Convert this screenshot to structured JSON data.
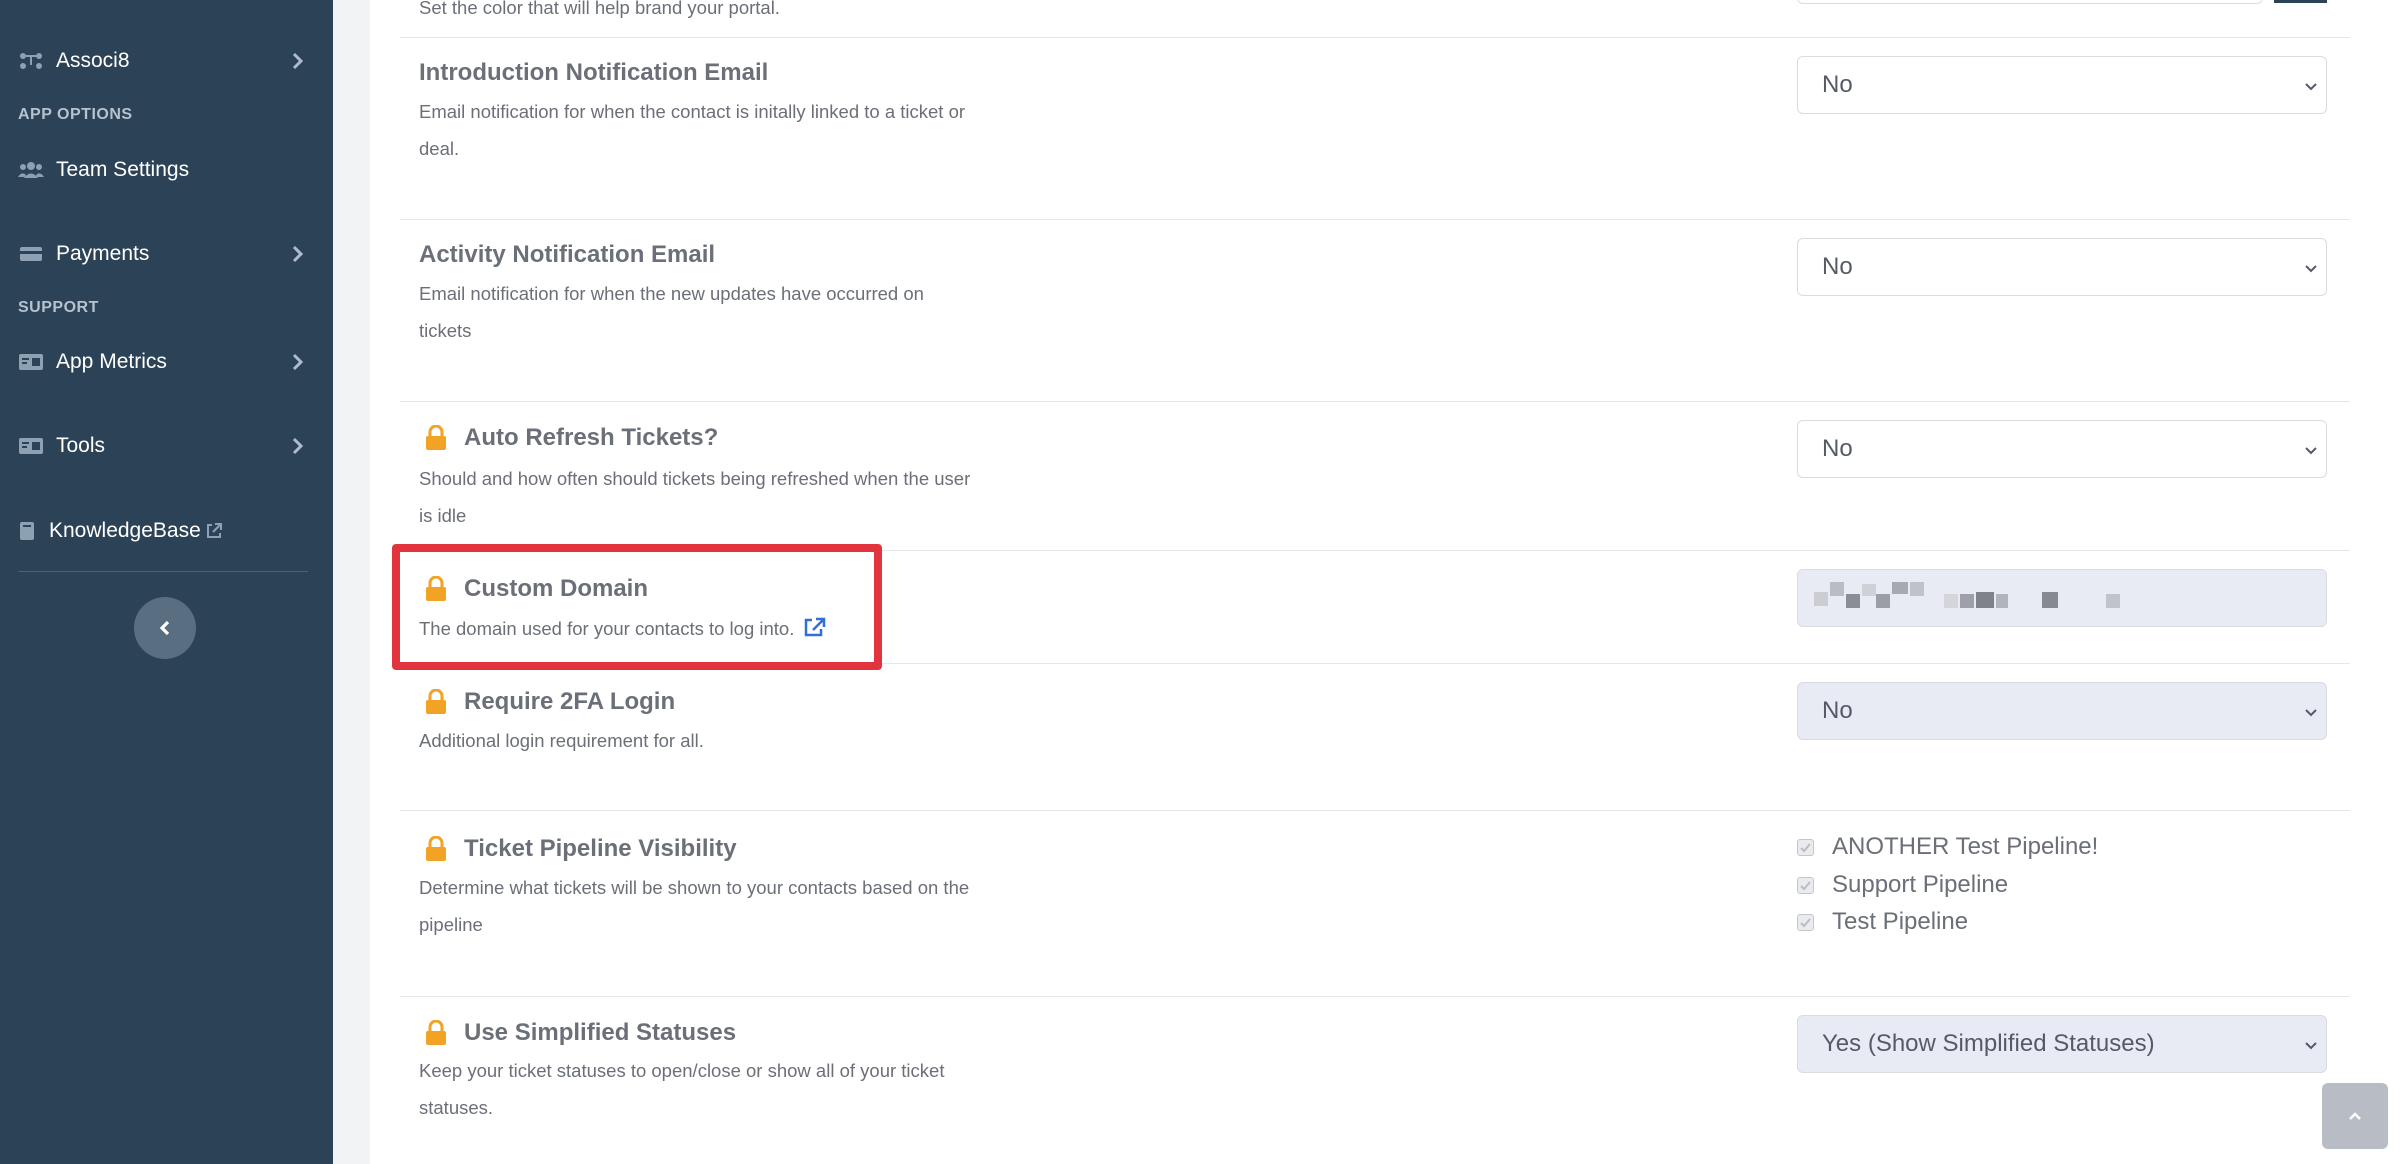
{
  "sidebar": {
    "items": [
      {
        "label": "Associ8",
        "icon": "network-icon"
      },
      {
        "label": "Team Settings",
        "icon": "users-icon"
      },
      {
        "label": "Payments",
        "icon": "card-icon"
      },
      {
        "label": "App Metrics",
        "icon": "id-card-icon"
      },
      {
        "label": "Tools",
        "icon": "id-card-icon"
      },
      {
        "label": "KnowledgeBase",
        "icon": "book-icon"
      }
    ],
    "sections": {
      "app_options": "APP OPTIONS",
      "support": "SUPPORT"
    }
  },
  "top_fragment": "Set the color that will help brand your portal.",
  "settings": {
    "intro_email": {
      "title": "Introduction Notification Email",
      "desc": "Email notification for when the contact is initally linked to a ticket or deal.",
      "value": "No"
    },
    "activity_email": {
      "title": "Activity Notification Email",
      "desc": "Email notification for when the new updates have occurred on tickets",
      "value": "No"
    },
    "auto_refresh": {
      "title": "Auto Refresh Tickets?",
      "desc": "Should and how often should tickets being refreshed when the user is idle",
      "value": "No"
    },
    "custom_domain": {
      "title": "Custom Domain",
      "desc": "The domain used for your contacts to log into."
    },
    "require_2fa": {
      "title": "Require 2FA Login",
      "desc": "Additional login requirement for all.",
      "value": "No"
    },
    "pipeline_visibility": {
      "title": "Ticket Pipeline Visibility",
      "desc": "Determine what tickets will be shown to your contacts based on the pipeline",
      "options": [
        "ANOTHER Test Pipeline!",
        "Support Pipeline",
        "Test Pipeline"
      ]
    },
    "simplified_statuses": {
      "title": "Use Simplified Statuses",
      "desc": "Keep your ticket statuses to open/close or show all of your ticket statuses.",
      "value": "Yes (Show Simplified Statuses)"
    }
  },
  "colors": {
    "sidebar_bg": "#2c4257",
    "lock": "#f2a324",
    "highlight": "#e2343d",
    "link": "#2f6fd6"
  }
}
